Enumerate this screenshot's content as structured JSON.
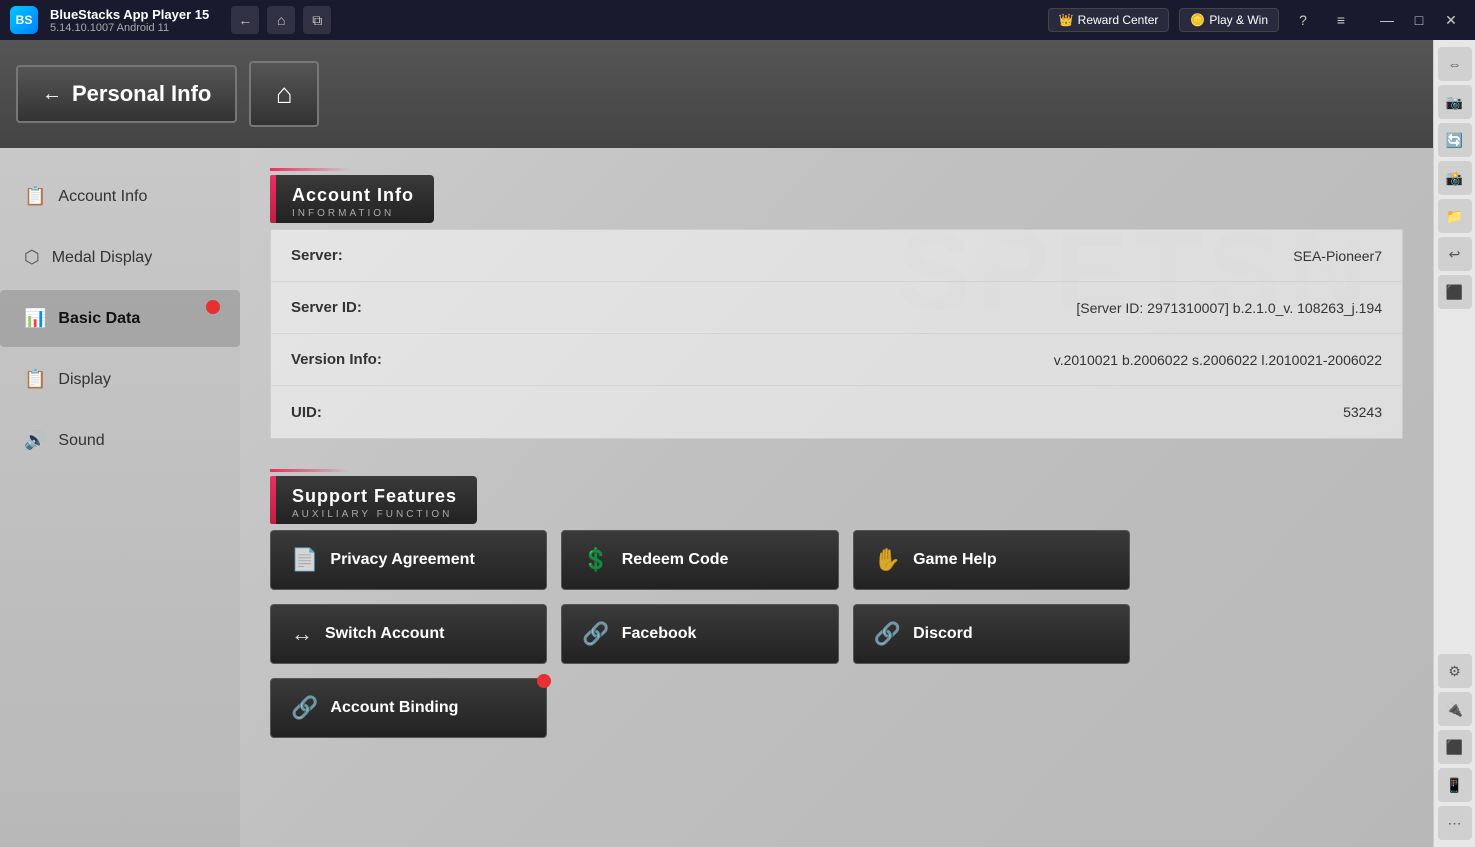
{
  "titleBar": {
    "appName": "BlueStacks App Player 15",
    "version": "5.14.10.1007  Android 11",
    "logoText": "BS",
    "navBack": "←",
    "navHome": "⌂",
    "navCopy": "⧉",
    "rewardCenter": "Reward Center",
    "playWin": "Play & Win",
    "helpIcon": "?",
    "menuIcon": "≡",
    "minimizeIcon": "—",
    "maximizeIcon": "□",
    "closeIcon": "✕"
  },
  "header": {
    "backArrow": "←",
    "personalInfo": "Personal Info",
    "homeIcon": "⌂"
  },
  "sidebar": {
    "items": [
      {
        "id": "account-info",
        "icon": "📋",
        "label": "Account Info",
        "active": false,
        "badge": false
      },
      {
        "id": "medal-display",
        "icon": "🏅",
        "label": "Medal Display",
        "active": false,
        "badge": false
      },
      {
        "id": "basic-data",
        "icon": "📊",
        "label": "Basic Data",
        "active": true,
        "badge": true
      },
      {
        "id": "display",
        "icon": "📋",
        "label": "Display",
        "active": false,
        "badge": false
      },
      {
        "id": "sound",
        "icon": "🔊",
        "label": "Sound",
        "active": false,
        "badge": false
      }
    ]
  },
  "accountInfo": {
    "sectionTitle": "Account Info",
    "sectionSubtitle": "INFORMATION",
    "rows": [
      {
        "label": "Server:",
        "value": "SEA-Pioneer7"
      },
      {
        "label": "Server ID:",
        "value": "[Server ID: 2971310007] b.2.1.0_v. 108263_j.194"
      },
      {
        "label": "Version Info:",
        "value": "v.2010021 b.2006022 s.2006022 l.2010021-2006022"
      },
      {
        "label": "UID:",
        "value": "53243"
      }
    ]
  },
  "supportFeatures": {
    "sectionTitle": "Support Features",
    "sectionSubtitle": "AUXILIARY FUNCTION",
    "buttons": [
      {
        "id": "privacy-agreement",
        "icon": "📄",
        "label": "Privacy Agreement",
        "badge": false
      },
      {
        "id": "redeem-code",
        "icon": "💲",
        "label": "Redeem Code",
        "badge": false
      },
      {
        "id": "game-help",
        "icon": "✋",
        "label": "Game Help",
        "badge": false
      },
      {
        "id": "switch-account",
        "icon": "↔",
        "label": "Switch Account",
        "badge": false
      },
      {
        "id": "facebook",
        "icon": "🔗",
        "label": "Facebook",
        "badge": false
      },
      {
        "id": "discord",
        "icon": "🔗",
        "label": "Discord",
        "badge": false
      },
      {
        "id": "account-binding",
        "icon": "🔗",
        "label": "Account Binding",
        "badge": true
      }
    ]
  },
  "watermark": "SPETSN",
  "rightSidebar": {
    "icons": [
      "⇔",
      "📷",
      "🔄",
      "📸",
      "📁",
      "↩",
      "⬛",
      "⚙",
      "🔌",
      "⬛",
      "📱"
    ]
  }
}
